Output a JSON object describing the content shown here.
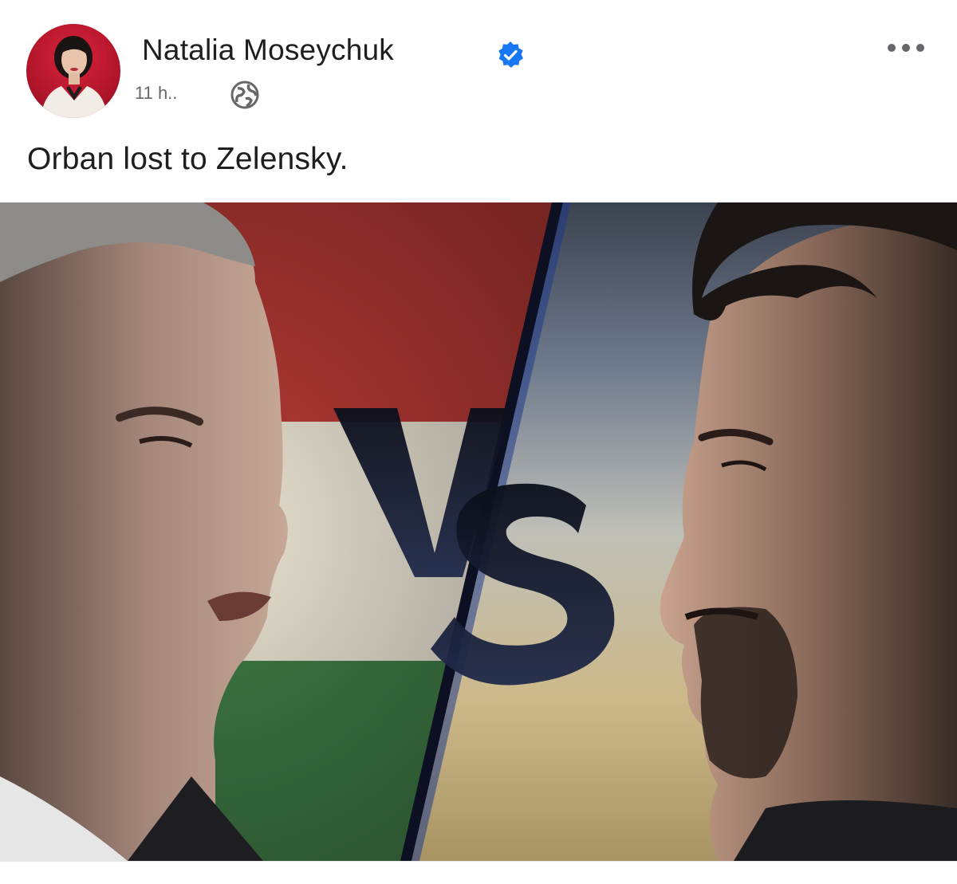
{
  "post": {
    "author": {
      "name": "Natalia Moseychuk",
      "verified": true,
      "avatar_icon": "user-avatar"
    },
    "timestamp": "11 h..",
    "audience_icon": "globe-icon",
    "menu_icon": "more-options-icon",
    "caption": "Orban lost to Zelensky.",
    "image": {
      "overlay_text": "VS"
    }
  },
  "colors": {
    "verified_badge": "#1877f2",
    "text_primary": "#1c1e21",
    "text_secondary": "#65676b",
    "hungary_red": "#b83a36",
    "hungary_white": "#e9e2d2",
    "hungary_green": "#3f7a45"
  }
}
